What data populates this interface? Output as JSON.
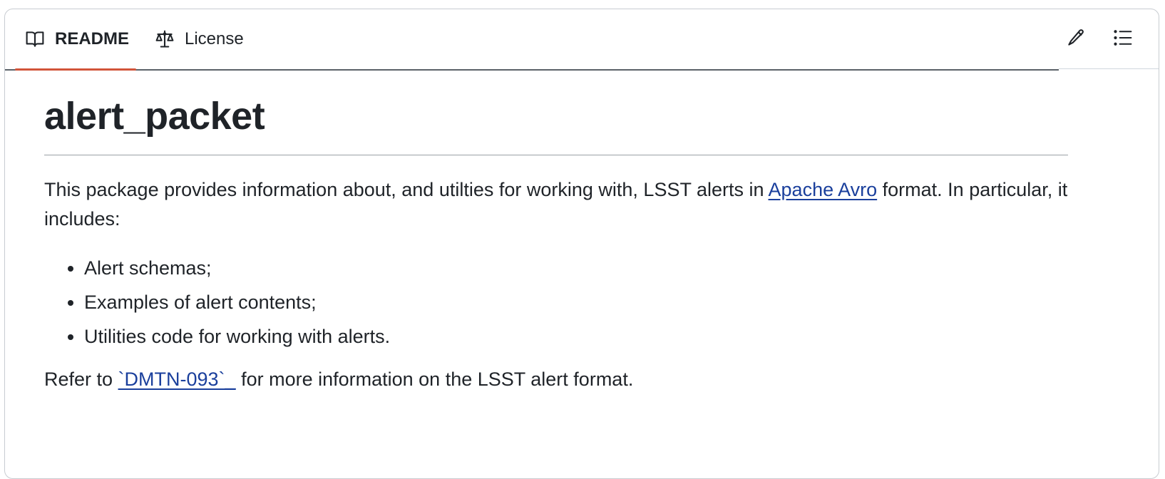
{
  "tabs": {
    "readme_label": "README",
    "license_label": "License"
  },
  "actions": {
    "edit_icon": "pencil-icon",
    "outline_icon": "list-unordered-icon"
  },
  "readme": {
    "title": "alert_packet",
    "intro_before": "This package provides information about, and utilties for working with, LSST alerts in ",
    "intro_link": "Apache Avro",
    "intro_after": " format. In particular, it includes:",
    "items": [
      "Alert schemas;",
      "Examples of alert contents;",
      "Utilities code for working with alerts."
    ],
    "refer_before": "Refer to ",
    "refer_link": "`DMTN-093`_",
    "refer_after": " for more information on the LSST alert format."
  },
  "colors": {
    "active_tab_underline": "#d2543a",
    "link": "#1a3f9c",
    "text": "#1f2328"
  }
}
